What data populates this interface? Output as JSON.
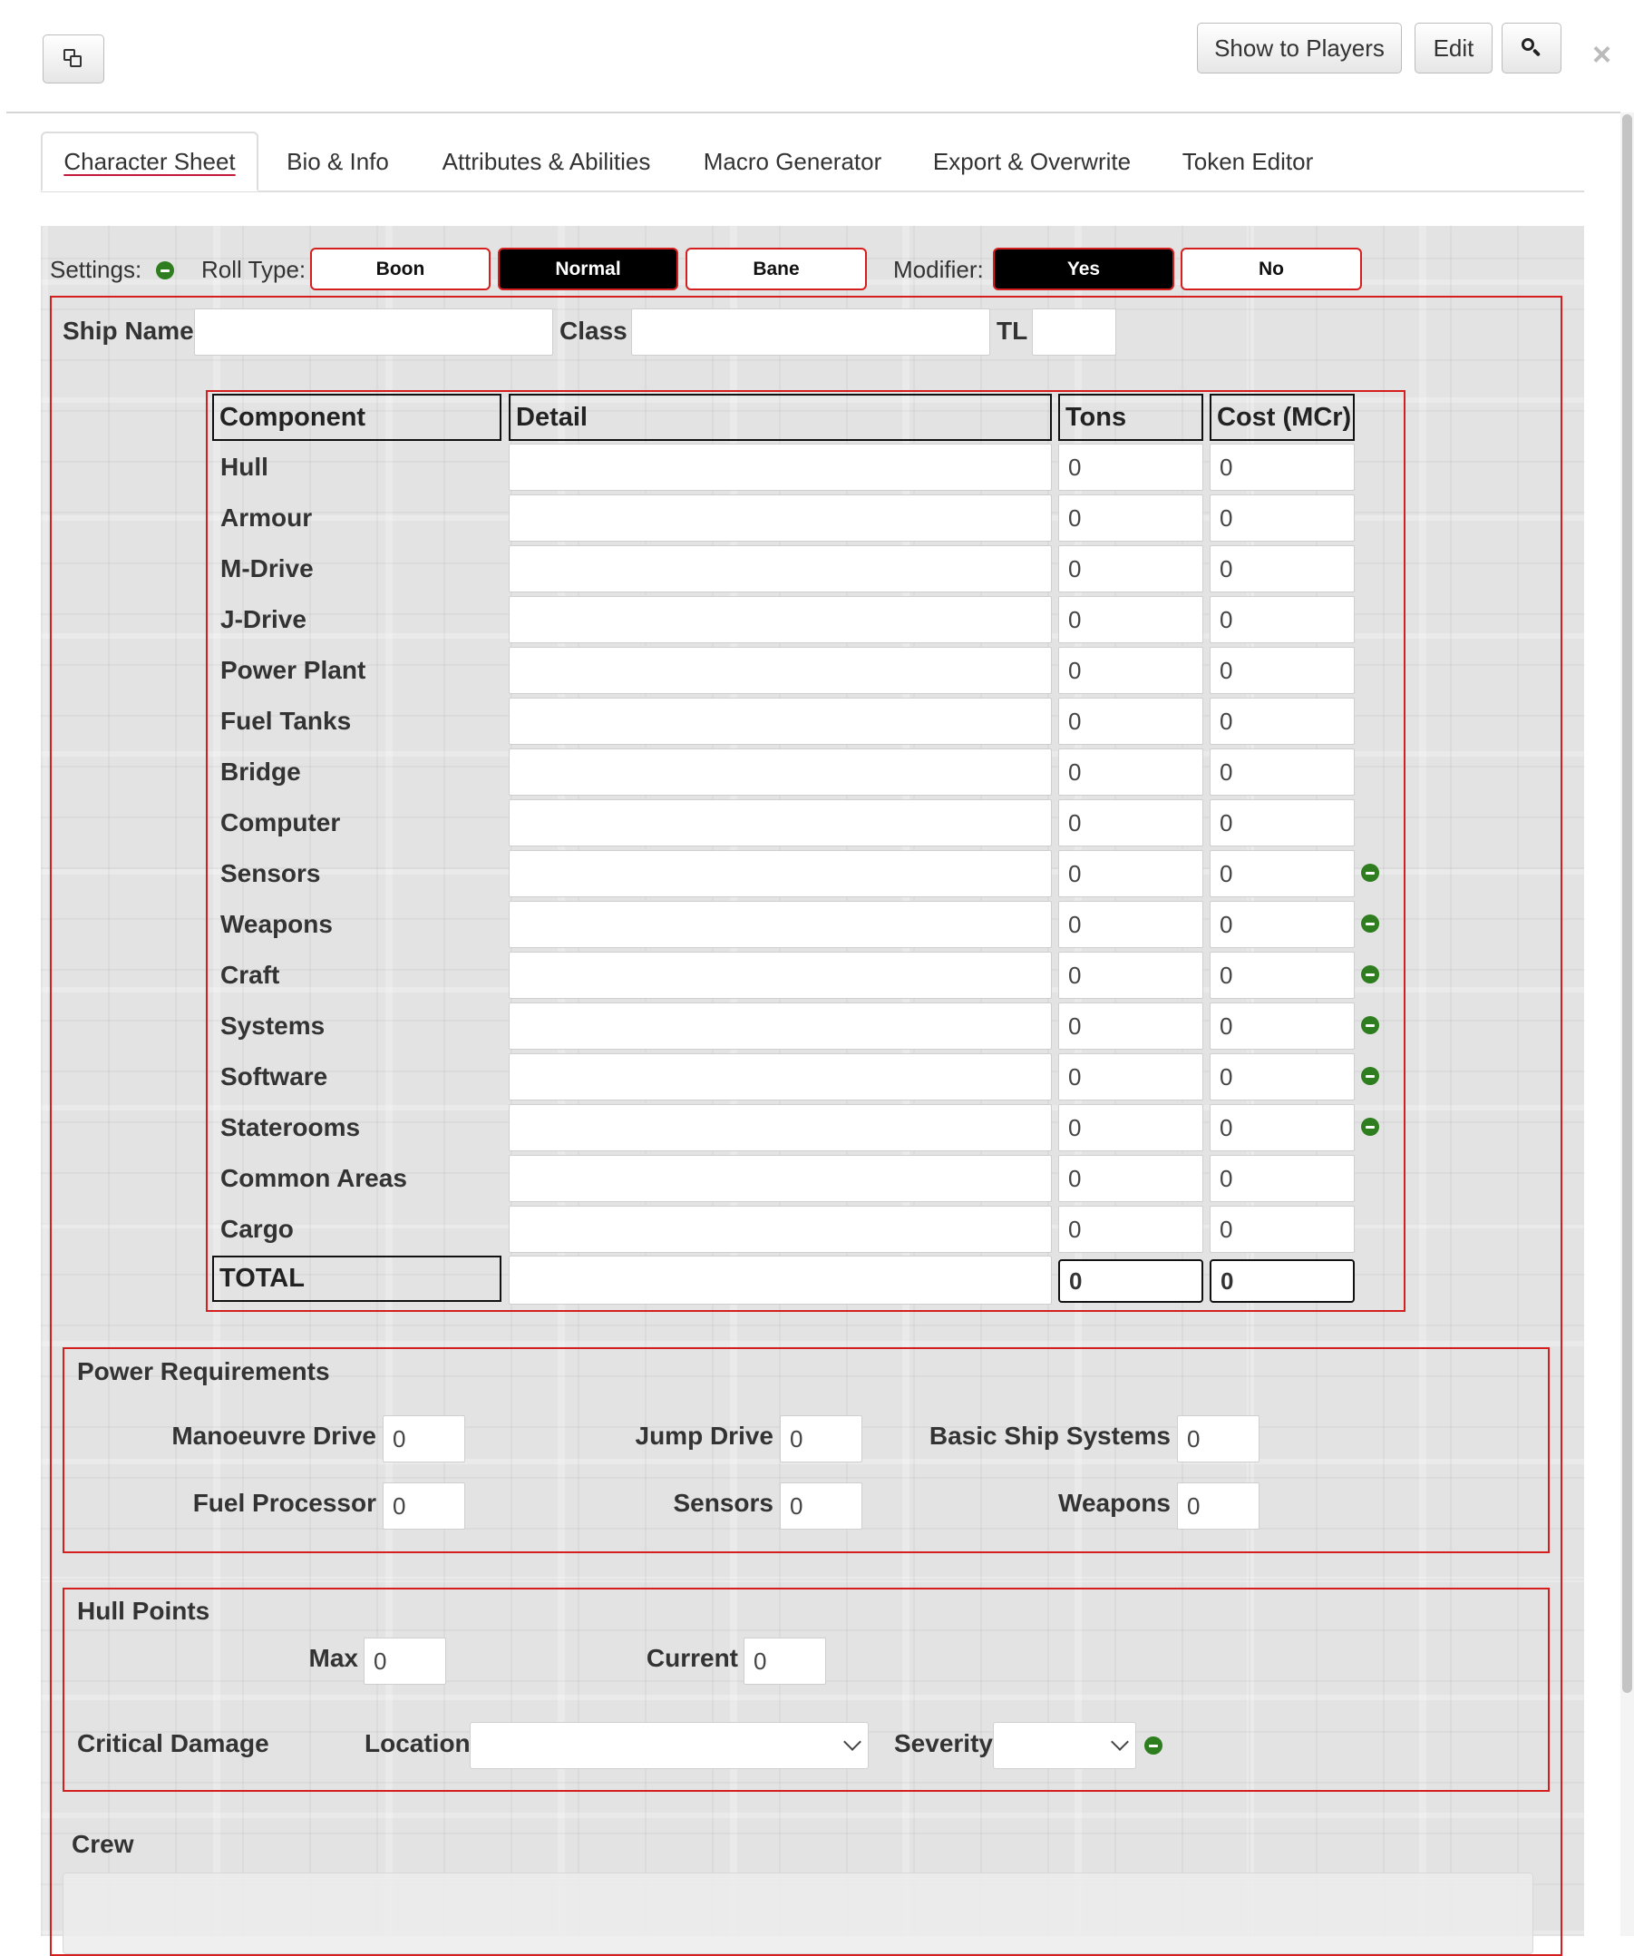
{
  "window": {
    "copy_icon": "copy-icon",
    "show_to_players": "Show to Players",
    "edit": "Edit",
    "search_icon": "search-icon",
    "close_glyph": "×"
  },
  "tabs": [
    {
      "label": "Character Sheet",
      "active": true
    },
    {
      "label": "Bio & Info",
      "active": false
    },
    {
      "label": "Attributes & Abilities",
      "active": false
    },
    {
      "label": "Macro Generator",
      "active": false
    },
    {
      "label": "Export & Overwrite",
      "active": false
    },
    {
      "label": "Token Editor",
      "active": false
    }
  ],
  "settings": {
    "label": "Settings:",
    "roll_type_label": "Roll Type:",
    "roll_types": [
      {
        "label": "Boon",
        "selected": false
      },
      {
        "label": "Normal",
        "selected": true
      },
      {
        "label": "Bane",
        "selected": false
      }
    ],
    "modifier_label": "Modifier:",
    "modifiers": [
      {
        "label": "Yes",
        "selected": true
      },
      {
        "label": "No",
        "selected": false
      }
    ]
  },
  "ship": {
    "name_label": "Ship Name",
    "name_value": "",
    "class_label": "Class",
    "class_value": "",
    "tl_label": "TL",
    "tl_value": ""
  },
  "components": {
    "headers": {
      "component": "Component",
      "detail": "Detail",
      "tons": "Tons",
      "cost": "Cost (MCr)"
    },
    "rows": [
      {
        "name": "Hull",
        "detail": "",
        "tons": "0",
        "cost": "0",
        "removable": false
      },
      {
        "name": "Armour",
        "detail": "",
        "tons": "0",
        "cost": "0",
        "removable": false
      },
      {
        "name": "M-Drive",
        "detail": "",
        "tons": "0",
        "cost": "0",
        "removable": false
      },
      {
        "name": "J-Drive",
        "detail": "",
        "tons": "0",
        "cost": "0",
        "removable": false
      },
      {
        "name": "Power Plant",
        "detail": "",
        "tons": "0",
        "cost": "0",
        "removable": false
      },
      {
        "name": "Fuel Tanks",
        "detail": "",
        "tons": "0",
        "cost": "0",
        "removable": false
      },
      {
        "name": "Bridge",
        "detail": "",
        "tons": "0",
        "cost": "0",
        "removable": false
      },
      {
        "name": "Computer",
        "detail": "",
        "tons": "0",
        "cost": "0",
        "removable": false
      },
      {
        "name": "Sensors",
        "detail": "",
        "tons": "0",
        "cost": "0",
        "removable": true
      },
      {
        "name": "Weapons",
        "detail": "",
        "tons": "0",
        "cost": "0",
        "removable": true
      },
      {
        "name": "Craft",
        "detail": "",
        "tons": "0",
        "cost": "0",
        "removable": true
      },
      {
        "name": "Systems",
        "detail": "",
        "tons": "0",
        "cost": "0",
        "removable": true
      },
      {
        "name": "Software",
        "detail": "",
        "tons": "0",
        "cost": "0",
        "removable": true
      },
      {
        "name": "Staterooms",
        "detail": "",
        "tons": "0",
        "cost": "0",
        "removable": true
      },
      {
        "name": "Common Areas",
        "detail": "",
        "tons": "0",
        "cost": "0",
        "removable": false
      },
      {
        "name": "Cargo",
        "detail": "",
        "tons": "0",
        "cost": "0",
        "removable": false
      }
    ],
    "total": {
      "label": "TOTAL",
      "detail": "",
      "tons": "0",
      "cost": "0"
    }
  },
  "power": {
    "title": "Power Requirements",
    "manoeuvre_label": "Manoeuvre Drive",
    "manoeuvre_value": "0",
    "jump_label": "Jump Drive",
    "jump_value": "0",
    "basic_label": "Basic Ship Systems",
    "basic_value": "0",
    "fuel_label": "Fuel Processor",
    "fuel_value": "0",
    "sensors_label": "Sensors",
    "sensors_value": "0",
    "weapons_label": "Weapons",
    "weapons_value": "0"
  },
  "hull": {
    "title": "Hull Points",
    "max_label": "Max",
    "max_value": "0",
    "current_label": "Current",
    "current_value": "0",
    "critical_label": "Critical Damage",
    "location_label": "Location",
    "location_value": "",
    "severity_label": "Severity",
    "severity_value": ""
  },
  "crew": {
    "title": "Crew"
  },
  "colors": {
    "accent_red": "#d51f1f",
    "remove_green": "#2e7d1e",
    "tab_underline": "#c5193c"
  }
}
